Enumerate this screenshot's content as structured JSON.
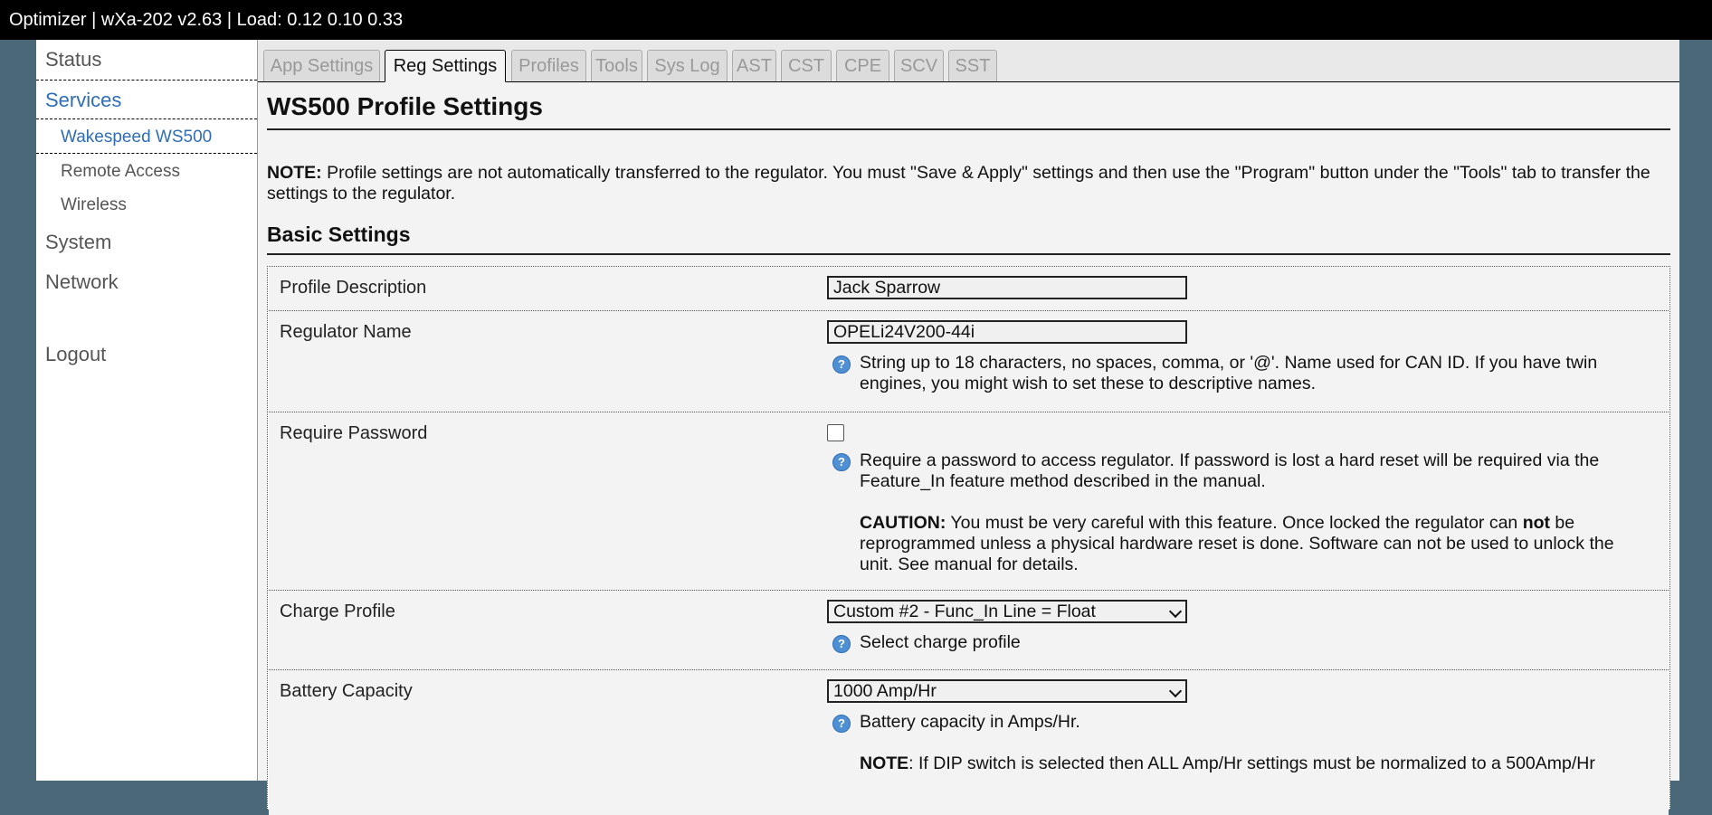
{
  "topbar": {
    "title": "Optimizer | wXa-202 v2.63 | Load: 0.12 0.10 0.33"
  },
  "sidebar": {
    "status": "Status",
    "services": "Services",
    "services_sub": [
      "Wakespeed WS500",
      "Remote Access",
      "Wireless"
    ],
    "system": "System",
    "network": "Network",
    "logout": "Logout"
  },
  "tabs": [
    "App Settings",
    "Reg Settings",
    "Profiles",
    "Tools",
    "Sys Log",
    "AST",
    "CST",
    "CPE",
    "SCV",
    "SST"
  ],
  "active_tab": "Reg Settings",
  "main": {
    "title": "WS500 Profile Settings",
    "note_label": "NOTE:",
    "note_text": " Profile settings are not automatically transferred to the regulator. You must \"Save & Apply\" settings and then use the \"Program\" button under the \"Tools\" tab to transfer the settings to the regulator.",
    "section": "Basic Settings"
  },
  "fields": {
    "profile_description": {
      "label": "Profile Description",
      "value": "Jack Sparrow"
    },
    "regulator_name": {
      "label": "Regulator Name",
      "value": "OPELi24V200-44i",
      "help": "String up to 18 characters, no spaces, comma, or '@'. Name used for CAN ID. If you have twin engines, you might wish to set these to descriptive names."
    },
    "require_password": {
      "label": "Require Password",
      "checked": false,
      "help": "Require a password to access regulator. If password is lost a hard reset will be required via the Feature_In feature method described in the manual.",
      "caution_label": "CAUTION:",
      "caution_text_1": " You must be very careful with this feature. Once locked the regulator can ",
      "caution_bold": "not",
      "caution_text_2": " be reprogrammed unless a physical hardware reset is done. Software can not be used to unlock the unit. See manual for details."
    },
    "charge_profile": {
      "label": "Charge Profile",
      "value": "Custom #2 - Func_In Line = Float",
      "help": "Select charge profile"
    },
    "battery_capacity": {
      "label": "Battery Capacity",
      "value": "1000 Amp/Hr",
      "help": "Battery capacity in Amps/Hr.",
      "note_label": "NOTE",
      "note_text": ": If DIP switch is selected then ALL Amp/Hr settings must be normalized to a 500Amp/Hr"
    }
  },
  "colors": {
    "topbar": "#000000",
    "background": "#4a6878",
    "link": "#2f6db5",
    "help_icon": "#4f8fd4"
  }
}
